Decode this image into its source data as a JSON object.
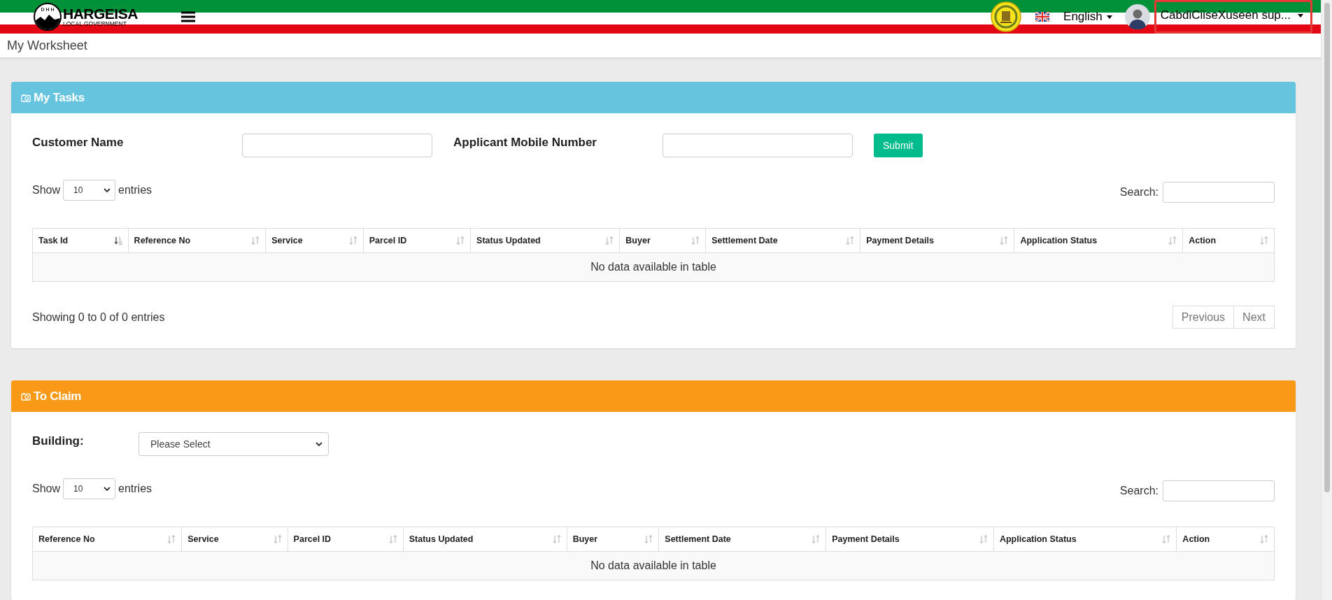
{
  "header": {
    "logo": {
      "mark": "D H H",
      "title": "HARGEISA",
      "subtitle": "LOCAL GOVERNMENT"
    },
    "language": "English",
    "user": {
      "name": "CabdiCiiseXuseen sup...",
      "highlighted": true
    }
  },
  "page_title": "My Worksheet",
  "panels": [
    {
      "title": "My Tasks",
      "color": "#67c4df",
      "filters": [
        {
          "kind": "text",
          "label": "Customer Name"
        },
        {
          "kind": "text",
          "label": "Applicant Mobile Number"
        }
      ],
      "submit": "Submit",
      "length": {
        "show": "Show",
        "value": "10",
        "entries": "entries"
      },
      "search": "Search:",
      "columns": [
        {
          "label": "Task Id",
          "sorted": true
        },
        {
          "label": "Reference No",
          "sorted": false
        },
        {
          "label": "Service",
          "sorted": false
        },
        {
          "label": "Parcel ID",
          "sorted": false
        },
        {
          "label": "Status Updated",
          "sorted": false
        },
        {
          "label": "Buyer",
          "sorted": false
        },
        {
          "label": "Settlement Date",
          "sorted": false
        },
        {
          "label": "Payment Details",
          "sorted": false
        },
        {
          "label": "Application Status",
          "sorted": false
        },
        {
          "label": "Action",
          "sorted": false
        }
      ],
      "empty": "No data available in table",
      "info": "Showing 0 to 0 of 0 entries",
      "pager": [
        {
          "label": "Previous",
          "disabled": true
        },
        {
          "label": "Next",
          "disabled": true
        }
      ]
    },
    {
      "title": "To Claim",
      "color": "#f89a17",
      "filters": [
        {
          "kind": "select",
          "label": "Building:",
          "value": "Please Select"
        }
      ],
      "length": {
        "show": "Show",
        "value": "10",
        "entries": "entries"
      },
      "search": "Search:",
      "columns": [
        {
          "label": "Reference No",
          "sorted": false
        },
        {
          "label": "Service",
          "sorted": false
        },
        {
          "label": "Parcel ID",
          "sorted": false
        },
        {
          "label": "Status Updated",
          "sorted": false
        },
        {
          "label": "Buyer",
          "sorted": false
        },
        {
          "label": "Settlement Date",
          "sorted": false
        },
        {
          "label": "Payment Details",
          "sorted": false
        },
        {
          "label": "Application Status",
          "sorted": false
        },
        {
          "label": "Action",
          "sorted": false
        }
      ],
      "empty": "No data available in table"
    }
  ]
}
